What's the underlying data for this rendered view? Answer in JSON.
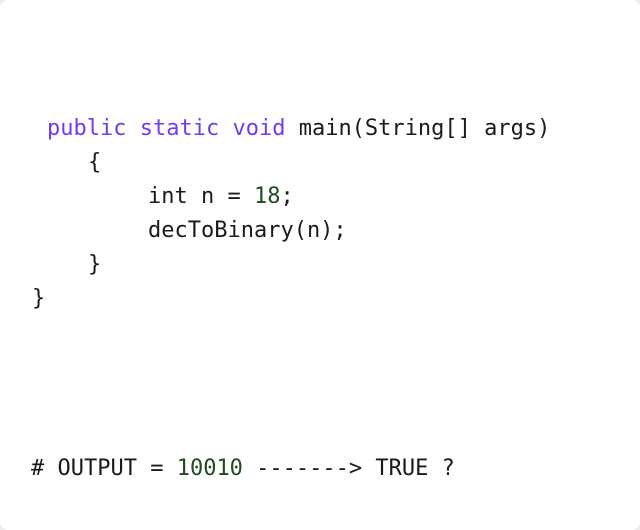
{
  "code": {
    "signature": {
      "kw_public": "public",
      "kw_static": "static",
      "kw_void": "void",
      "method": "main(String[] args)"
    },
    "open_brace": "{",
    "line_int_prefix": "int n = ",
    "line_int_value": "18",
    "line_int_suffix": ";",
    "line_call": "decToBinary(n);",
    "inner_close_brace": "}",
    "outer_close_brace": "}"
  },
  "output": {
    "prefix": "# OUTPUT = ",
    "value": "10010",
    "suffix": " -------> TRUE ?"
  },
  "colors": {
    "keyword": "#6f3cf0",
    "number": "#1f4d1f",
    "text": "#1a1a1a",
    "background": "#ffffff"
  }
}
